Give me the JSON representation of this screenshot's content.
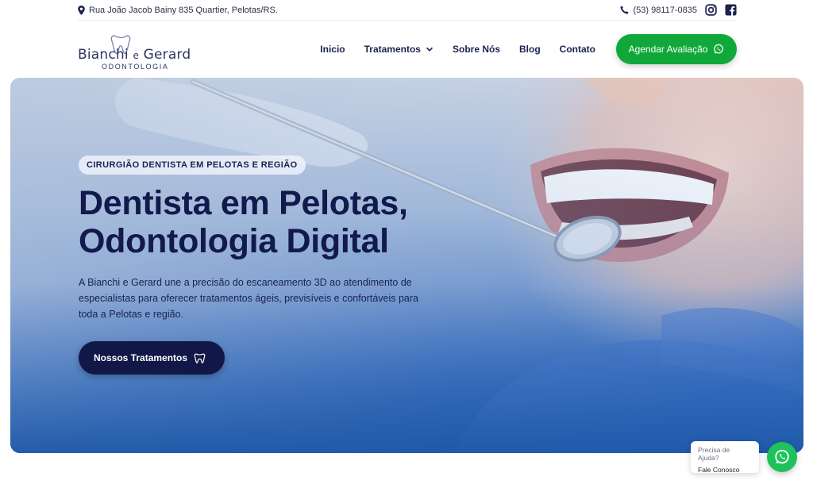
{
  "topbar": {
    "address": "Rua João Jacob Bainy 835 Quartier, Pelotas/RS.",
    "phone": "(53) 98117-0835",
    "icons": [
      "map-pin-icon",
      "phone-icon",
      "instagram-icon",
      "facebook-icon"
    ]
  },
  "brand": {
    "name_left": "Bianchi",
    "name_join": "e",
    "name_right": "Gerard",
    "subtitle": "ODONTOLOGIA"
  },
  "nav": {
    "items": [
      {
        "label": "Inicio"
      },
      {
        "label": "Tratamentos",
        "has_dropdown": true
      },
      {
        "label": "Sobre Nós"
      },
      {
        "label": "Blog"
      },
      {
        "label": "Contato"
      }
    ],
    "cta_label": "Agendar Avaliação"
  },
  "hero": {
    "eyebrow": "CIRURGIÃO DENTISTA EM PELOTAS E REGIÃO",
    "title_line1": "Dentista em Pelotas,",
    "title_line2": "Odontologia Digital",
    "description": "A Bianchi e Gerard une a precisão do escaneamento 3D ao atendimento de especialistas para oferecer tratamentos ágeis, previsíveis e confortáveis para toda a Pelotas e região.",
    "button_label": "Nossos Tratamentos"
  },
  "chat": {
    "question": "Precisa de Ajuda?",
    "answer": "Fale Conosco"
  },
  "colors": {
    "navy": "#121a4d",
    "green": "#11a83a",
    "whatsapp": "#1fc25a",
    "hero_blue": "#1f5aab"
  }
}
